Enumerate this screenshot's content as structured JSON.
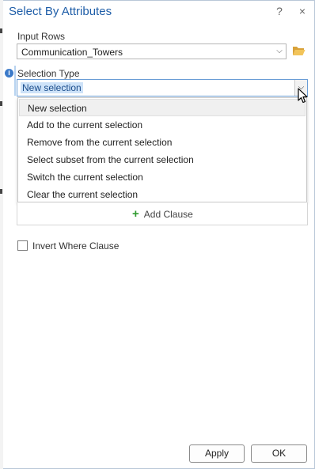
{
  "dialog": {
    "title": "Select By Attributes",
    "help_button": "?",
    "close_button": "×"
  },
  "input_rows": {
    "label": "Input Rows",
    "value": "Communication_Towers"
  },
  "selection_type": {
    "label": "Selection Type",
    "value": "New selection",
    "options": [
      "New selection",
      "Add to the current selection",
      "Remove from the current selection",
      "Select subset from the current selection",
      "Switch the current selection",
      "Clear the current selection"
    ]
  },
  "clause": {
    "add_label": "Add Clause"
  },
  "invert": {
    "label": "Invert Where Clause",
    "checked": false
  },
  "footer": {
    "apply": "Apply",
    "ok": "OK"
  },
  "colors": {
    "title": "#1f5ea8",
    "accent_plus": "#2f9a2f",
    "selection_highlight": "#cde2f8",
    "folder": "#e8b64a"
  }
}
